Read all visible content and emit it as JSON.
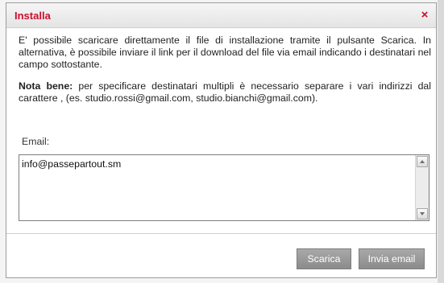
{
  "dialog": {
    "title": "Installa",
    "close_icon": "×"
  },
  "content": {
    "paragraph1": "E' possibile scaricare direttamente il file di installazione tramite il pulsante Scarica. In alternativa, è possibile inviare il link per il download del file via email indicando i destinatari nel campo sottostante.",
    "note_label": "Nota bene:",
    "note_text": " per specificare destinatari multipli è necessario separare i vari indirizzi dal carattere , (es. studio.rossi@gmail.com, studio.bianchi@gmail.com)."
  },
  "email": {
    "label": "Email:",
    "value": "info@passepartout.sm"
  },
  "buttons": {
    "scarica": "Scarica",
    "invia": "Invia email"
  },
  "colors": {
    "title_red": "#c8102e",
    "button_gray": "#999999"
  },
  "icons": {
    "close": "close-icon",
    "scroll_up": "arrow-up-icon",
    "scroll_down": "arrow-down-icon"
  }
}
